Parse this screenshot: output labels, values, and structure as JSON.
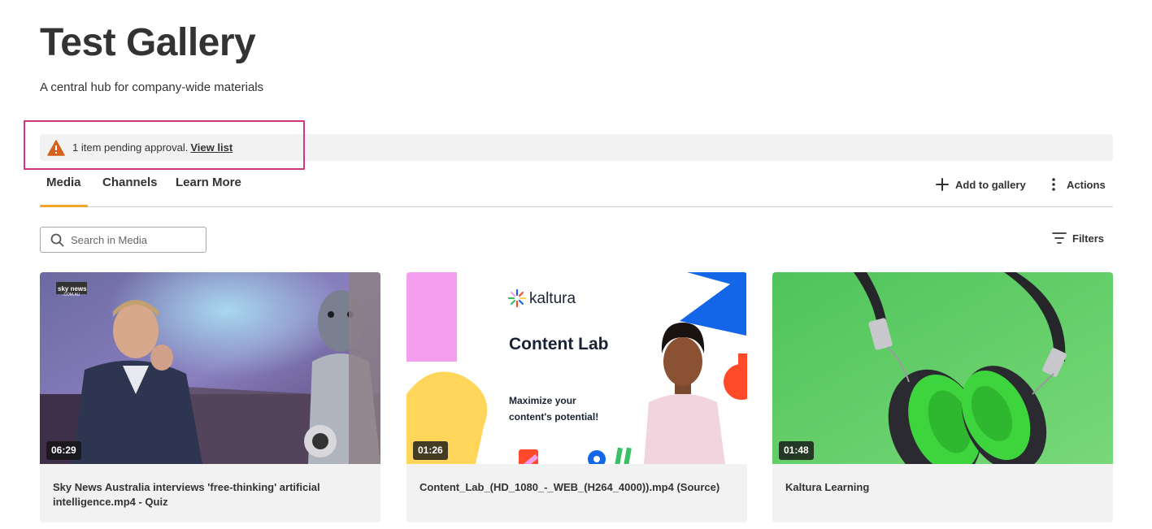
{
  "page": {
    "title": "Test Gallery",
    "description": "A central hub for company-wide materials"
  },
  "pending": {
    "icon": "warning-icon",
    "message": "1 item pending approval.",
    "link_label": "View list",
    "warning_color": "#d4611e",
    "highlight_color": "#d1377b"
  },
  "tabs": [
    {
      "label": "Media",
      "active": true
    },
    {
      "label": "Channels",
      "active": false
    },
    {
      "label": "Learn More",
      "active": false
    }
  ],
  "actions": {
    "add_label": "Add to gallery",
    "actions_label": "Actions"
  },
  "search": {
    "placeholder": "Search in Media",
    "value": ""
  },
  "filters": {
    "label": "Filters"
  },
  "accent_color": "#f2a52b",
  "media": [
    {
      "title": "Sky News Australia interviews 'free-thinking' artificial intelligence.mp4 - Quiz",
      "duration": "06:29",
      "thumb_logo": "sky news",
      "thumb_logo_sub": ".COM.AU"
    },
    {
      "title": "Content_Lab_(HD_1080_-_WEB_(H264_4000)).mp4 (Source)",
      "duration": "01:26",
      "thumb_brand": "kaltura",
      "thumb_heading": "Content Lab",
      "thumb_tagline_1": "Maximize your",
      "thumb_tagline_2": "content's potential!"
    },
    {
      "title": "Kaltura Learning",
      "duration": "01:48"
    }
  ]
}
